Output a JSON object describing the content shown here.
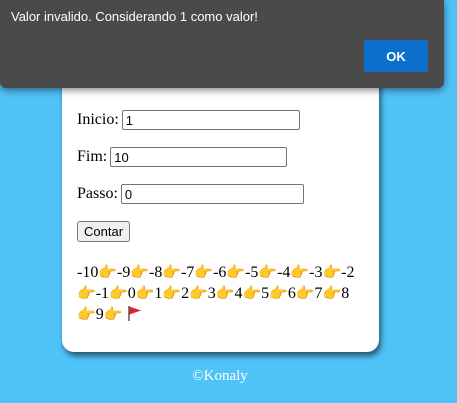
{
  "dialog": {
    "message": "Valor invalido. Considerando 1 como valor!",
    "ok_label": "OK"
  },
  "form": {
    "inicio_label": "Inicio:",
    "inicio_value": "1",
    "fim_label": "Fim:",
    "fim_value": "10",
    "passo_label": "Passo:",
    "passo_value": "0",
    "contar_label": "Contar"
  },
  "result": {
    "numbers": [
      "-10",
      "-9",
      "-8",
      "-7",
      "-6",
      "-5",
      "-4",
      "-3",
      "-2",
      "-1",
      "0",
      "1",
      "2",
      "3",
      "4",
      "5",
      "6",
      "7",
      "8",
      "9"
    ],
    "separator_icon": "pointing-hand-icon",
    "end_icon": "red-flag-icon"
  },
  "footer": {
    "text": "©Konaly"
  },
  "colors": {
    "background": "#4fc3f7",
    "dialog_bg": "#4a4a4a",
    "ok_button": "#0b6fcb"
  }
}
